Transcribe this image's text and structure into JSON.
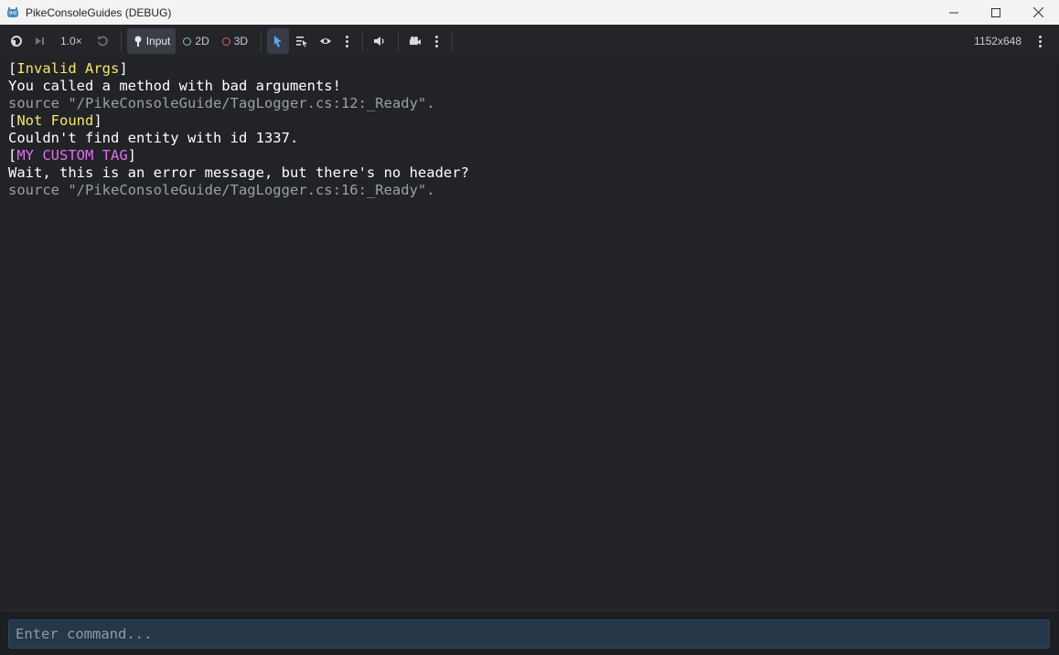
{
  "window": {
    "title": "PikeConsoleGuides (DEBUG)",
    "minimize_icon": "minimize-icon",
    "maximize_icon": "maximize-icon",
    "close_icon": "close-icon"
  },
  "toolbar": {
    "speed": "1.0×",
    "input_label": "Input",
    "mode_2d": "2D",
    "mode_3d": "3D",
    "resolution": "1152x648",
    "colors": {
      "accent": "#5fa7e8",
      "ring_2d": "#7ec8a0",
      "ring_3d": "#e85f5f"
    }
  },
  "console": {
    "lines": [
      {
        "parts": [
          {
            "text": "[",
            "style": ""
          },
          {
            "text": "Invalid Args",
            "style": "yellow"
          },
          {
            "text": "]",
            "style": ""
          }
        ]
      },
      {
        "parts": [
          {
            "text": "You called a method with bad arguments!",
            "style": ""
          }
        ]
      },
      {
        "parts": [
          {
            "text": "source \"/PikeConsoleGuide/TagLogger.cs:12:_Ready\".",
            "style": "dim"
          }
        ]
      },
      {
        "parts": [
          {
            "text": "[",
            "style": ""
          },
          {
            "text": "Not Found",
            "style": "yellow"
          },
          {
            "text": "]",
            "style": ""
          }
        ]
      },
      {
        "parts": [
          {
            "text": "Couldn't find entity with id 1337.",
            "style": ""
          }
        ]
      },
      {
        "parts": [
          {
            "text": "[",
            "style": ""
          },
          {
            "text": "MY CUSTOM TAG",
            "style": "magenta"
          },
          {
            "text": "]",
            "style": ""
          }
        ]
      },
      {
        "parts": [
          {
            "text": "Wait, this is an error message, but there's no header?",
            "style": ""
          }
        ]
      },
      {
        "parts": [
          {
            "text": "source \"/PikeConsoleGuide/TagLogger.cs:16:_Ready\".",
            "style": "dim"
          }
        ]
      }
    ]
  },
  "command": {
    "placeholder": "Enter command...",
    "value": ""
  }
}
